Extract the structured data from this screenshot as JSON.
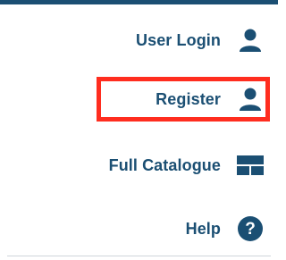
{
  "menu": {
    "items": [
      {
        "label": "User Login",
        "icon": "user-icon"
      },
      {
        "label": "Register",
        "icon": "user-icon"
      },
      {
        "label": "Full Catalogue",
        "icon": "catalogue-grid-icon"
      },
      {
        "label": "Help",
        "icon": "help-circle-icon"
      }
    ]
  },
  "colors": {
    "accent": "#1b4f73",
    "highlight": "#ff2d1f",
    "divider": "#cfd5da"
  }
}
